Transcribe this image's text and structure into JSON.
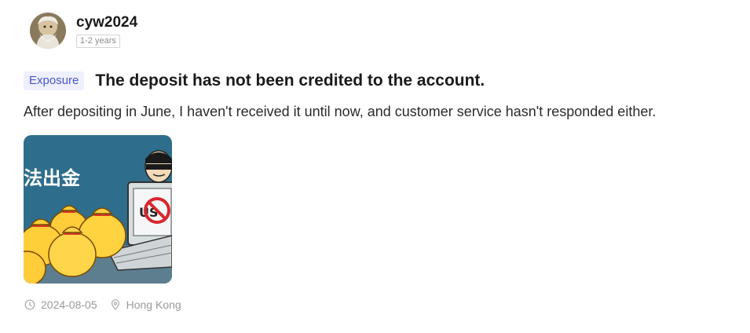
{
  "user": {
    "name": "cyw2024",
    "tenure": "1-2 years"
  },
  "post": {
    "tag": "Exposure",
    "title": "The deposit has not been credited to the account.",
    "body": "After depositing in June, I haven't received it until now, and customer service hasn't responded either.",
    "image": {
      "caption_chars": "法出金"
    }
  },
  "meta": {
    "date": "2024-08-05",
    "location": "Hong Kong"
  },
  "icons": {
    "date": "clock-icon",
    "location": "location-pin-icon"
  },
  "colors": {
    "tag_bg": "#eef0ff",
    "tag_text": "#4a55c9",
    "meta_text": "#9a9a9a"
  }
}
